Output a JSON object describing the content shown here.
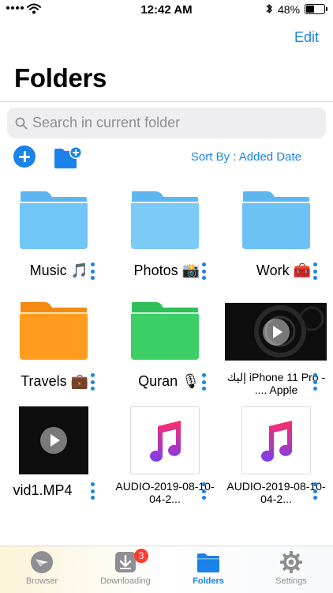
{
  "status_bar": {
    "time": "12:42 AM",
    "battery_text": "48%",
    "battery_level": 0.48,
    "icons": [
      "signal-icon",
      "wifi-icon",
      "bluetooth-icon",
      "battery-icon"
    ]
  },
  "header": {
    "edit_label": "Edit",
    "title": "Folders"
  },
  "search": {
    "placeholder": "Search in current folder"
  },
  "toolbar": {
    "sort_label": "Sort By : Added Date",
    "add_icon": "plus-circle-icon",
    "new_folder_icon": "folder-plus-icon"
  },
  "items": [
    {
      "label": "Music 🎵",
      "kind": "folder",
      "color": "light-blue"
    },
    {
      "label": "Photos 📸",
      "kind": "folder",
      "color": "light-blue"
    },
    {
      "label": "Work 🧰",
      "kind": "folder",
      "color": "light-blue"
    },
    {
      "label": "Travels 💼",
      "kind": "folder",
      "color": "orange"
    },
    {
      "label": "Quran 🎙",
      "kind": "folder",
      "color": "green"
    },
    {
      "label": "إليك iPhone 11 Pro - .... Apple",
      "kind": "video"
    },
    {
      "label": "vid1.MP4",
      "kind": "video"
    },
    {
      "label": "AUDIO-2019-08-10-04-2...",
      "kind": "audio"
    },
    {
      "label": "AUDIO-2019-08-10-04-2...",
      "kind": "audio"
    }
  ],
  "tabs": [
    {
      "label": "Browser",
      "icon": "compass-icon"
    },
    {
      "label": "Downloading",
      "icon": "download-icon",
      "badge": "3"
    },
    {
      "label": "Folders",
      "icon": "folder-icon"
    },
    {
      "label": "Settings",
      "icon": "gear-icon"
    }
  ],
  "colors": {
    "accent": "#1a82e8",
    "badge": "#ff3b30",
    "folder_blue": "#6cc2f5",
    "folder_orange": "#ff9b1f",
    "folder_green": "#3ccf65"
  }
}
